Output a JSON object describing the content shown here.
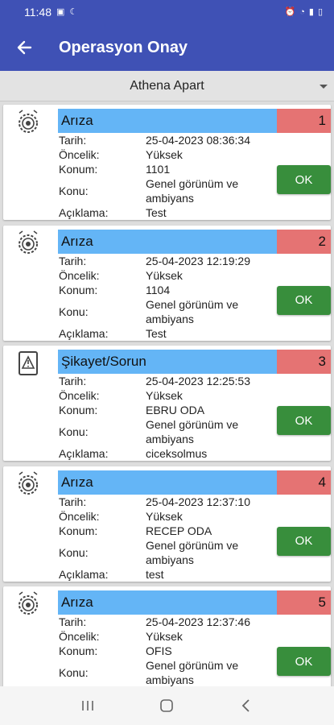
{
  "status_bar": {
    "time": "11:48"
  },
  "header": {
    "title": "Operasyon Onay"
  },
  "selector": {
    "value": "Athena Apart"
  },
  "field_labels": {
    "date": "Tarih:",
    "priority": "Öncelik:",
    "location": "Konum:",
    "subject": "Konu:",
    "description": "Açıklama:"
  },
  "ok_label": "OK",
  "items": [
    {
      "type": "Arıza",
      "icon": "fault-gear-icon",
      "number": "1",
      "date": "25-04-2023 08:36:34",
      "priority": "Yüksek",
      "location": "1101",
      "subject": "Genel görünüm ve ambiyans",
      "description": "Test"
    },
    {
      "type": "Arıza",
      "icon": "fault-gear-icon",
      "number": "2",
      "date": "25-04-2023 12:19:29",
      "priority": "Yüksek",
      "location": "1104",
      "subject": "Genel görünüm ve ambiyans",
      "description": "Test"
    },
    {
      "type": "Şikayet/Sorun",
      "icon": "complaint-warning-icon",
      "number": "3",
      "date": "25-04-2023 12:25:53",
      "priority": "Yüksek",
      "location": "EBRU ODA",
      "subject": "Genel görünüm ve ambiyans",
      "description": "ciceksolmus"
    },
    {
      "type": "Arıza",
      "icon": "fault-gear-icon",
      "number": "4",
      "date": "25-04-2023 12:37:10",
      "priority": "Yüksek",
      "location": "RECEP ODA",
      "subject": "Genel görünüm ve ambiyans",
      "description": "test"
    },
    {
      "type": "Arıza",
      "icon": "fault-gear-icon",
      "number": "5",
      "date": "25-04-2023 12:37:46",
      "priority": "Yüksek",
      "location": "OFIS",
      "subject": "Genel görünüm ve ambiyans",
      "description": ""
    }
  ],
  "colors": {
    "app_bar": "#3f51b5",
    "card_header": "#64b5f6",
    "number_badge": "#e57373",
    "ok_button": "#388e3c"
  }
}
